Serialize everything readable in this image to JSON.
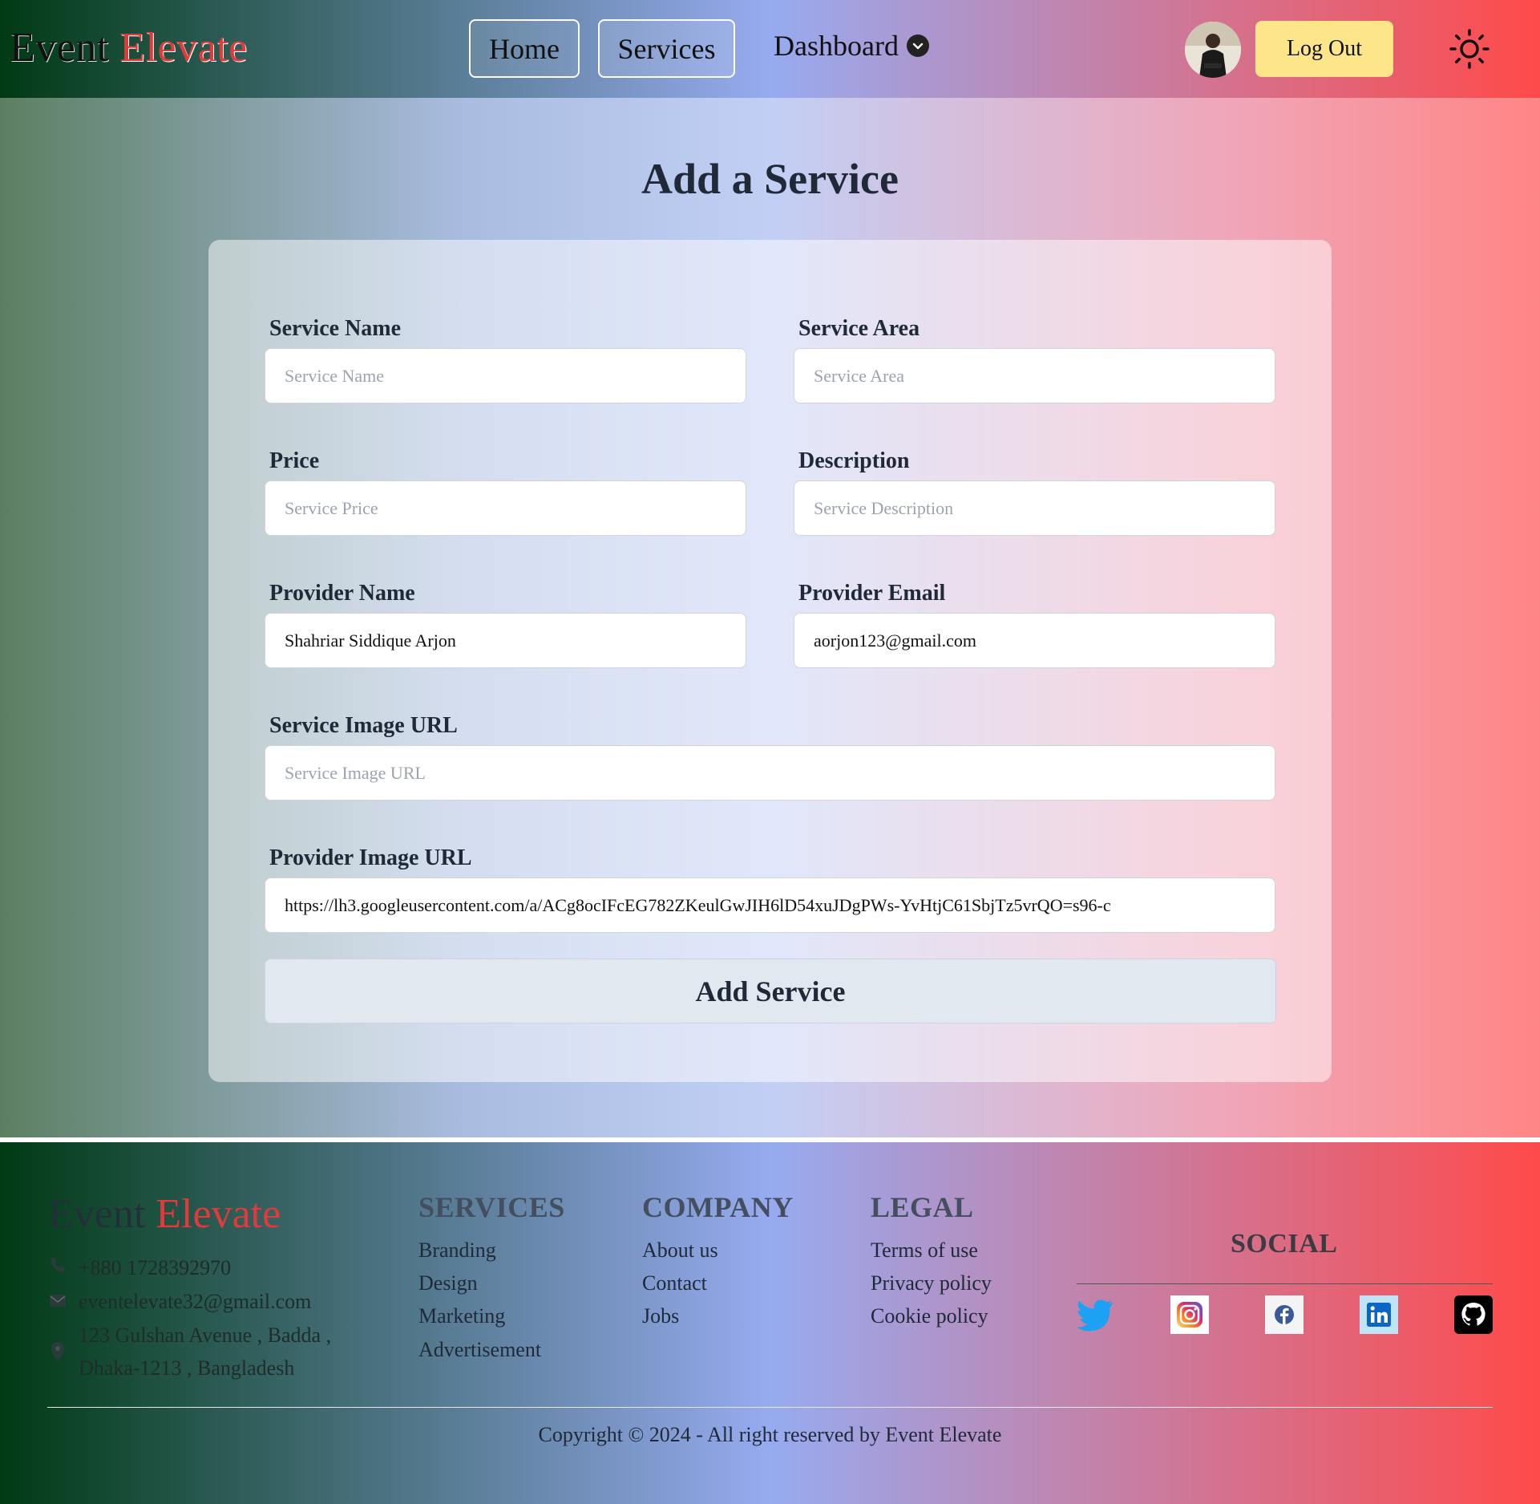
{
  "nav": {
    "logo_word1": "Event",
    "logo_word2": "Elevate",
    "home": "Home",
    "services": "Services",
    "dashboard": "Dashboard",
    "logout": "Log Out"
  },
  "page": {
    "title": "Add a Service",
    "fields": {
      "service_name": {
        "label": "Service Name",
        "placeholder": "Service Name",
        "value": ""
      },
      "service_area": {
        "label": "Service Area",
        "placeholder": "Service Area",
        "value": ""
      },
      "price": {
        "label": "Price",
        "placeholder": "Service Price",
        "value": ""
      },
      "description": {
        "label": "Description",
        "placeholder": "Service Description",
        "value": ""
      },
      "provider_name": {
        "label": "Provider Name",
        "placeholder": "",
        "value": "Shahriar Siddique Arjon"
      },
      "provider_email": {
        "label": "Provider Email",
        "placeholder": "",
        "value": "aorjon123@gmail.com"
      },
      "service_image_url": {
        "label": "Service Image URL",
        "placeholder": "Service Image URL",
        "value": ""
      },
      "provider_image_url": {
        "label": "Provider Image URL",
        "placeholder": "",
        "value": "https://lh3.googleusercontent.com/a/ACg8ocIFcEG782ZKeulGwJIH6lD54xuJDgPWs-YvHtjC61SbjTz5vrQO=s96-c"
      }
    },
    "submit": "Add Service"
  },
  "footer": {
    "logo_word1": "Event",
    "logo_word2": "Elevate",
    "phone": "+880 1728392970",
    "email": "eventelevate32@gmail.com",
    "address_line1": "123 Gulshan Avenue , Badda ,",
    "address_line2": "Dhaka-1213 , Bangladesh",
    "services_title": "SERVICES",
    "services_links": [
      "Branding",
      "Design",
      "Marketing",
      "Advertisement"
    ],
    "company_title": "COMPANY",
    "company_links": [
      "About us",
      "Contact",
      "Jobs"
    ],
    "legal_title": "LEGAL",
    "legal_links": [
      "Terms of use",
      "Privacy policy",
      "Cookie policy"
    ],
    "social_title": "SOCIAL",
    "social_icons": [
      "twitter-icon",
      "instagram-icon",
      "facebook-icon",
      "linkedin-icon",
      "github-icon"
    ],
    "copyright": "Copyright © 2024 - All right reserved by Event Elevate"
  },
  "colors": {
    "logo_accent": "#e03a3a",
    "logout_bg": "#fde68a",
    "submit_bg": "#e2e8f0",
    "gradient_left": "#003a14",
    "gradient_mid": "#97abf0",
    "gradient_right": "#ff4a4a"
  }
}
